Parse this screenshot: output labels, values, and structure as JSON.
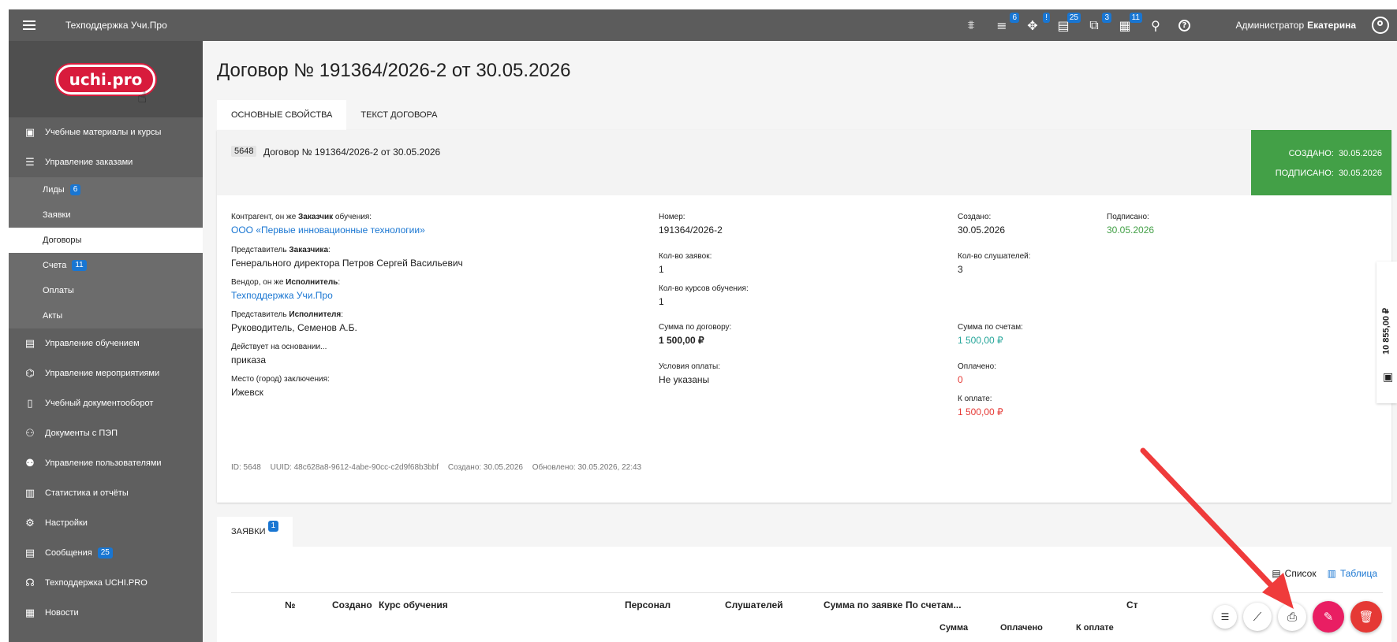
{
  "topbar": {
    "menu_icon": "menu-icon",
    "app_title": "Техподдержка Учи.Про",
    "icons": [
      {
        "name": "podium-icon",
        "glyph": "⩨",
        "badge": ""
      },
      {
        "name": "queue-icon",
        "glyph": "≡",
        "badge": "6"
      },
      {
        "name": "puzzle-icon",
        "glyph": "✥",
        "badge": "!"
      },
      {
        "name": "messages-icon",
        "glyph": "▤",
        "badge": "25"
      },
      {
        "name": "share-icon",
        "glyph": "⧉",
        "badge": "3"
      },
      {
        "name": "news-icon",
        "glyph": "▦",
        "badge": "11"
      },
      {
        "name": "lightbulb-icon",
        "glyph": "⚲",
        "badge": ""
      },
      {
        "name": "help-icon",
        "glyph": "?",
        "badge": ""
      }
    ],
    "user_role": "Администратор",
    "user_name": "Екатерина"
  },
  "sidebar": {
    "logo_text": "uchi.pro",
    "items": [
      {
        "name": "sidebar-item-materials",
        "icon": "▣",
        "label": "Учебные материалы и курсы"
      },
      {
        "name": "sidebar-item-orders",
        "icon": "☰",
        "label": "Управление заказами"
      }
    ],
    "sub_items": [
      {
        "label": "Лиды",
        "badge": "6"
      },
      {
        "label": "Заявки",
        "badge": ""
      },
      {
        "label": "Договоры",
        "badge": ""
      },
      {
        "label": "Счета",
        "badge": "11"
      },
      {
        "label": "Оплаты",
        "badge": ""
      },
      {
        "label": "Акты",
        "badge": ""
      }
    ],
    "items2": [
      {
        "icon": "▤",
        "label": "Управление обучением",
        "badge": ""
      },
      {
        "icon": "⌬",
        "label": "Управление мероприятиями",
        "badge": ""
      },
      {
        "icon": "▯",
        "label": "Учебный документооборот",
        "badge": ""
      },
      {
        "icon": "⚇",
        "label": "Документы с ПЭП",
        "badge": ""
      },
      {
        "icon": "⚉",
        "label": "Управление пользователями",
        "badge": ""
      },
      {
        "icon": "▥",
        "label": "Статистика и отчёты",
        "badge": ""
      },
      {
        "icon": "⚙",
        "label": "Настройки",
        "badge": ""
      },
      {
        "icon": "▤",
        "label": "Сообщения",
        "badge": "25"
      },
      {
        "icon": "☊",
        "label": "Техподдержка UCHI.PRO",
        "badge": ""
      },
      {
        "icon": "▦",
        "label": "Новости",
        "badge": ""
      }
    ]
  },
  "page": {
    "title": "Договор № 191364/2026-2 от 30.05.2026",
    "tabs": [
      "Основные свойства",
      "Текст договора"
    ]
  },
  "card": {
    "id_tag": "5648",
    "header_title": "Договор № 191364/2026-2 от 30.05.2026",
    "created_label": "СОЗДАНО:",
    "created_value": "30.05.2026",
    "signed_label": "ПОДПИСАНО:",
    "signed_value": "30.05.2026",
    "fields": {
      "counterparty_label_pre": "Контрагент, он же ",
      "counterparty_label_bold": "Заказчик",
      "counterparty_label_post": " обучения:",
      "counterparty_value": "ООО «Первые инновационные технологии»",
      "client_rep_label_pre": "Представитель ",
      "client_rep_label_bold": "Заказчика",
      "client_rep_label_post": ":",
      "client_rep_value": "Генерального директора Петров Сергей Васильевич",
      "vendor_label_pre": "Вендор, он же ",
      "vendor_label_bold": "Исполнитель",
      "vendor_label_post": ":",
      "vendor_value": "Техподдержка Учи.Про",
      "vendor_rep_label_pre": "Представитель ",
      "vendor_rep_label_bold": "Исполнителя",
      "vendor_rep_label_post": ":",
      "vendor_rep_value": "Руководитель, Семенов А.Б.",
      "basis_label": "Действует на основании...",
      "basis_value": "приказа",
      "place_label": "Место (город) заключения:",
      "place_value": "Ижевск",
      "number_label": "Номер:",
      "number_value": "191364/2026-2",
      "orders_count_label": "Кол-во заявок:",
      "orders_count_value": "1",
      "courses_count_label": "Кол-во курсов обучения:",
      "courses_count_value": "1",
      "contract_sum_label": "Сумма по договору:",
      "contract_sum_value": "1 500,00 ₽",
      "payment_terms_label": "Условия оплаты:",
      "payment_terms_value": "Не указаны",
      "created_label": "Создано:",
      "created_value": "30.05.2026",
      "listeners_label": "Кол-во слушателей:",
      "listeners_value": "3",
      "invoices_sum_label": "Сумма по счетам:",
      "invoices_sum_value": "1 500,00 ₽",
      "paid_label": "Оплачено:",
      "paid_value": "0",
      "to_pay_label": "К оплате:",
      "to_pay_value": "1 500,00 ₽",
      "signed_label": "Подписано:",
      "signed_value": "30.05.2026"
    },
    "meta": {
      "id": "ID:  5648",
      "uuid": "UUID:  48c628a8-9612-4abe-90cc-c2d9f68b3bbf",
      "created": "Создано:  30.05.2026",
      "updated": "Обновлено:  30.05.2026, 22:43"
    }
  },
  "side_tab": {
    "amount": "10 855,00 ₽",
    "icon": "wallet-icon"
  },
  "orders_section": {
    "tab_label": "ЗАЯВКИ",
    "tab_badge": "1",
    "view_list": "Список",
    "view_table": "Таблица",
    "columns": [
      "№",
      "Создано",
      "Курс обучения",
      "Персонал",
      "Слушателей",
      "Сумма по заявке",
      "По счетам...",
      "Ст"
    ],
    "sub_columns": [
      "Сумма",
      "Оплачено",
      "К оплате"
    ]
  },
  "fabs": {
    "list": "list-icon",
    "chart": "trend-icon",
    "print": "print-icon",
    "edit": "edit-icon",
    "delete": "delete-icon"
  },
  "colors": {
    "topbar": "#5c5c5c",
    "sidebar": "#5f5f5f",
    "accent": "#1976d2",
    "signed_green": "#43a047",
    "arrow_red": "#ef3b3b"
  }
}
